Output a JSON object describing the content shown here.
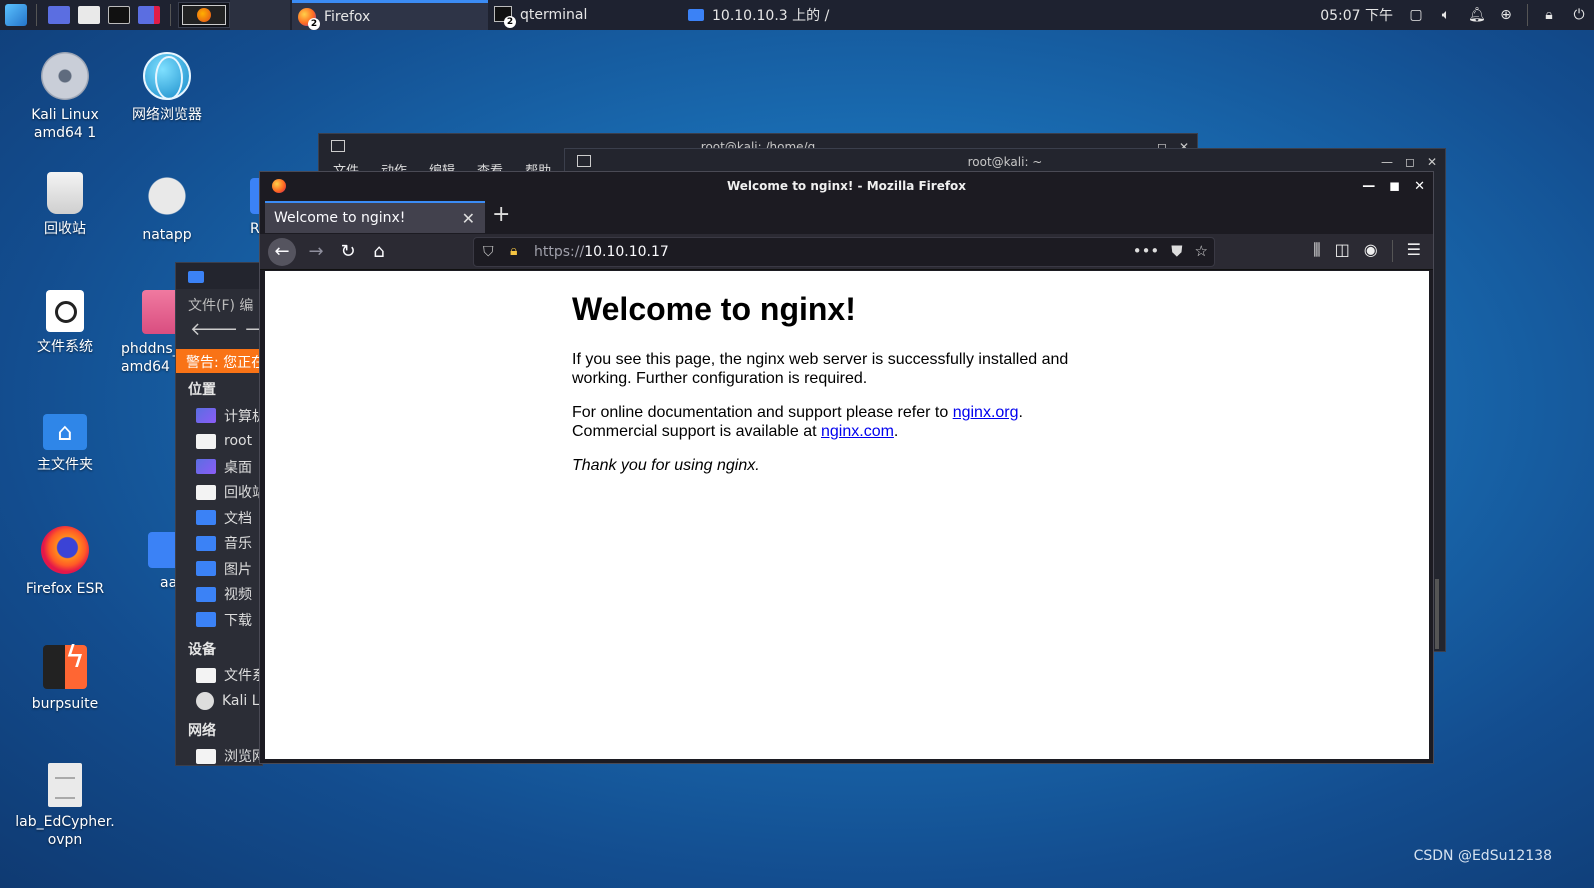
{
  "taskbar": {
    "tasks": [
      {
        "label": "Firefox",
        "badge": "2",
        "icon": "firefox-icon",
        "active": true
      },
      {
        "label": "qterminal",
        "badge": "2",
        "icon": "terminal-icon"
      },
      {
        "label": "10.10.10.3 上的 /",
        "icon": "folder-icon"
      }
    ],
    "clock": "05:07 下午"
  },
  "desktop": {
    "icons": [
      {
        "label": "Kali Linux amd64 1",
        "icon": "disc-icon"
      },
      {
        "label": "网络浏览器",
        "icon": "globe-icon"
      },
      {
        "label": "回收站",
        "icon": "trash-icon"
      },
      {
        "label": "natapp",
        "icon": "gear-icon"
      },
      {
        "label": "R",
        "icon": "folder-icon"
      },
      {
        "label": "文件系统",
        "icon": "filesystem-icon"
      },
      {
        "label": "phddns_ amd64",
        "icon": "package-icon"
      },
      {
        "label": "主文件夹",
        "icon": "home-folder-icon"
      },
      {
        "label": "Firefox ESR",
        "icon": "firefox-icon"
      },
      {
        "label": "aa",
        "icon": "folder-icon"
      },
      {
        "label": "burpsuite",
        "icon": "burpsuite-icon"
      },
      {
        "label": "lab_EdCypher.ovpn",
        "icon": "document-icon"
      }
    ]
  },
  "terminal_back": {
    "title": "root@kali: /home/q",
    "menu": [
      "文件",
      "动作",
      "编辑",
      "查看",
      "帮助"
    ]
  },
  "terminal_mid": {
    "title": "root@kali: ~"
  },
  "file_manager": {
    "menu": "文件(F)  编",
    "warning": "警告: 您正在",
    "sections": [
      {
        "title": "位置",
        "items": [
          "计算机",
          "root",
          "桌面",
          "回收站",
          "文档",
          "音乐",
          "图片",
          "视频",
          "下载"
        ]
      },
      {
        "title": "设备",
        "items": [
          "文件系统",
          "Kali L"
        ]
      },
      {
        "title": "网络",
        "items": [
          "浏览网络"
        ]
      }
    ]
  },
  "firefox": {
    "window_title": "Welcome to nginx! - Mozilla Firefox",
    "tab_title": "Welcome to nginx!",
    "url_protocol": "https://",
    "url_host": "10.10.10.17",
    "page": {
      "heading": "Welcome to nginx!",
      "p1": "If you see this page, the nginx web server is successfully installed and working. Further configuration is required.",
      "p2_prefix": "For online documentation and support please refer to ",
      "p2_link1": "nginx.org",
      "p2_middle": ".",
      "p2_line2_prefix": "Commercial support is available at ",
      "p2_link2": "nginx.com",
      "p2_suffix": ".",
      "p3": "Thank you for using nginx."
    }
  },
  "watermark": "CSDN @EdSu12138",
  "colors": {
    "accent": "#3b8cf5",
    "warning": "#f97316",
    "link": "#0000ee"
  }
}
